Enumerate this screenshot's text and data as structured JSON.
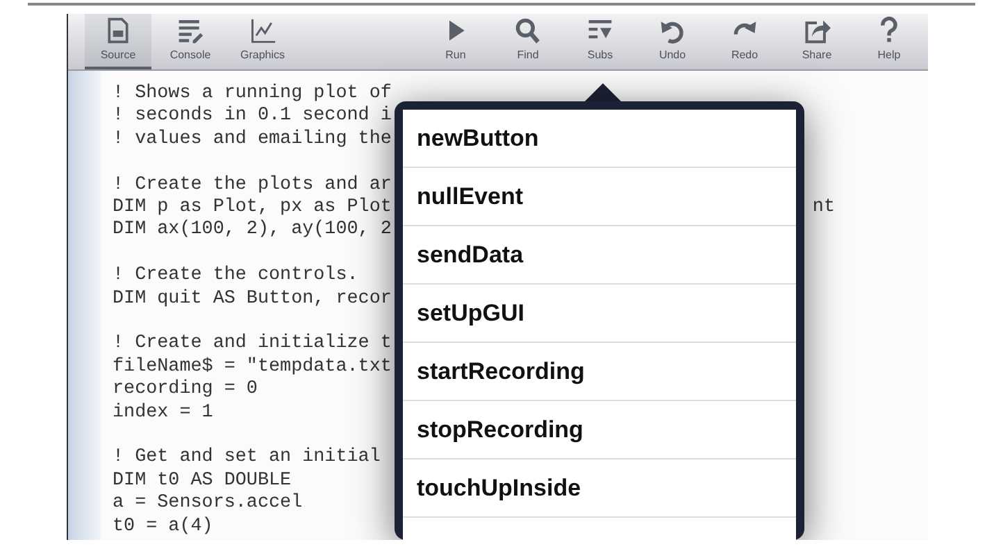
{
  "toolbar": {
    "left": [
      {
        "label": "Source",
        "selected": true
      },
      {
        "label": "Console",
        "selected": false
      },
      {
        "label": "Graphics",
        "selected": false
      }
    ],
    "right": [
      {
        "label": "Run"
      },
      {
        "label": "Find"
      },
      {
        "label": "Subs"
      },
      {
        "label": "Undo"
      },
      {
        "label": "Redo"
      },
      {
        "label": "Share"
      },
      {
        "label": "Help"
      }
    ]
  },
  "code_blocks": [
    [
      {
        "text": "! Shows a running plot of"
      },
      {
        "text": "! seconds in 0.1 second i"
      },
      {
        "text": "! values and emailing the"
      }
    ],
    [
      {
        "text": "! Create the plots and ar"
      },
      {
        "text": "DIM p as Plot, px as Plot",
        "tail": "nt"
      },
      {
        "text": "DIM ax(100, 2), ay(100, 2"
      }
    ],
    [
      {
        "text": "! Create the controls."
      },
      {
        "text": "DIM quit AS Button, recor"
      }
    ],
    [
      {
        "text": "! Create and initialize t"
      },
      {
        "text": "fileName$ = \"tempdata.txt"
      },
      {
        "text": "recording = 0"
      },
      {
        "text": "index = 1"
      }
    ],
    [
      {
        "text": "! Get and set an initial"
      },
      {
        "text": "DIM t0 AS DOUBLE"
      },
      {
        "text": "a = Sensors.accel"
      },
      {
        "text": "t0 = a(4)"
      }
    ]
  ],
  "popover": {
    "items": [
      "newButton",
      "nullEvent",
      "sendData",
      "setUpGUI",
      "startRecording",
      "stopRecording",
      "touchUpInside"
    ]
  }
}
